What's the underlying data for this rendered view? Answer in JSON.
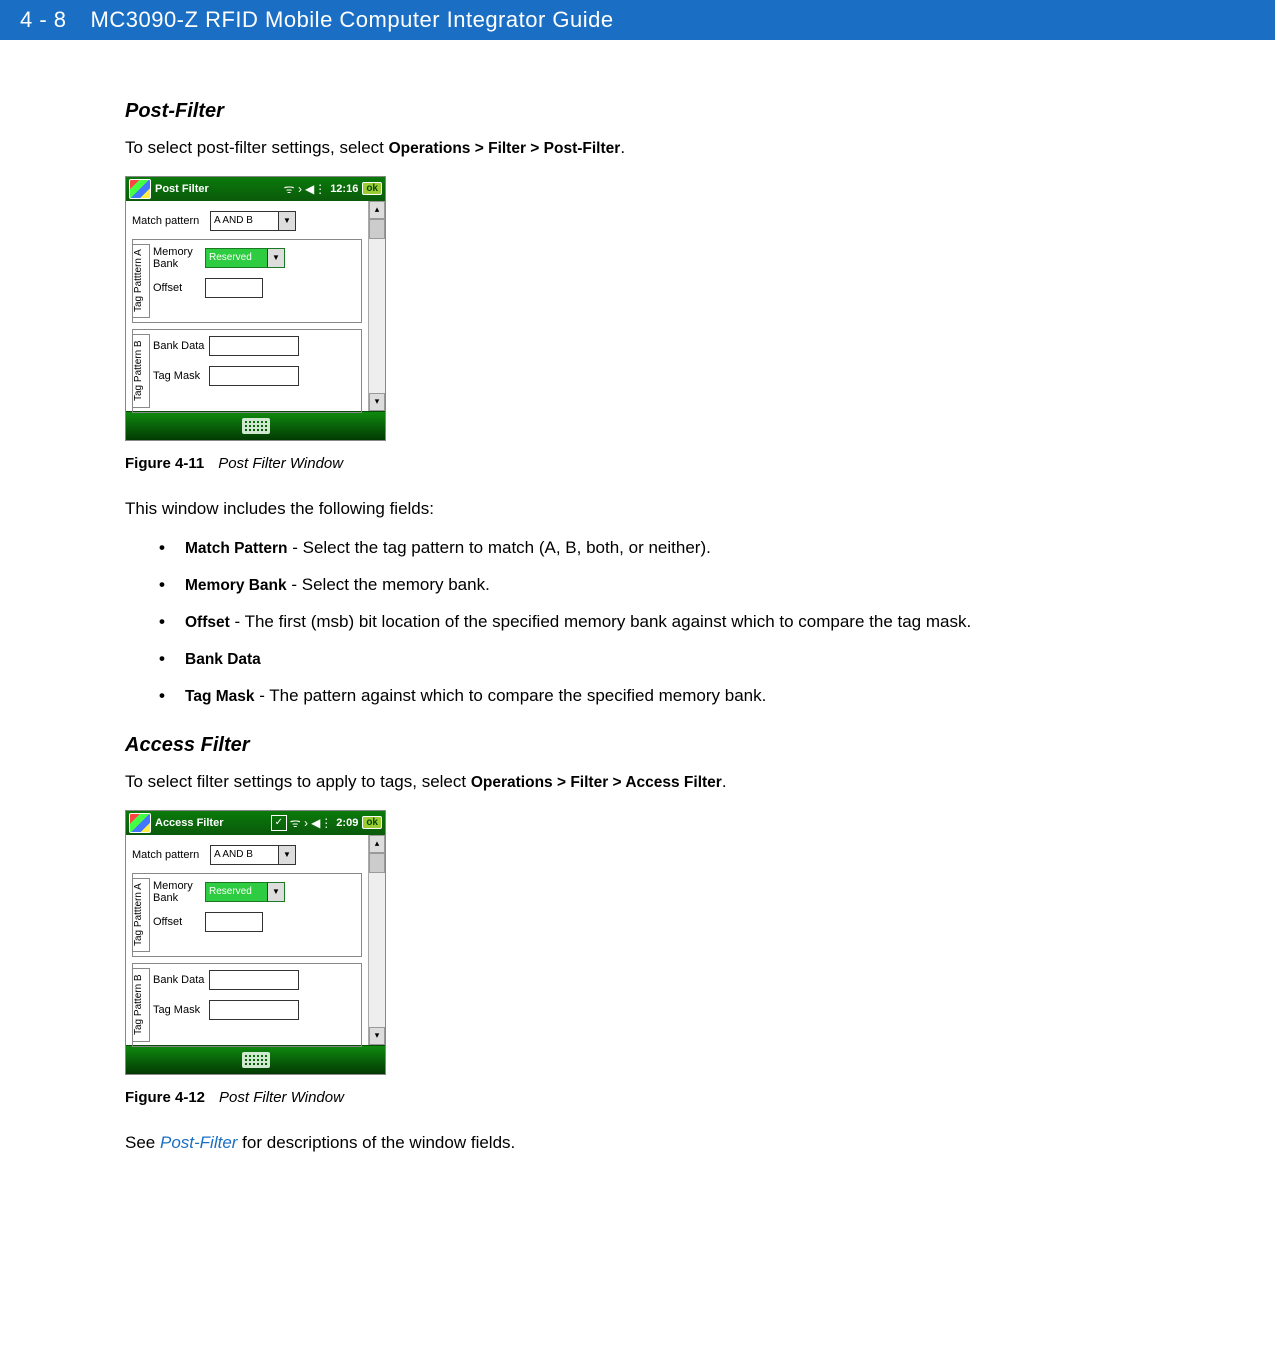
{
  "header": {
    "page_number": "4 - 8",
    "title": "MC3090-Z RFID Mobile Computer Integrator Guide"
  },
  "section1": {
    "heading": "Post-Filter",
    "intro_prefix": "To select post-filter settings, select ",
    "intro_path": "Operations > Filter > Post-Filter",
    "intro_suffix": "."
  },
  "device1": {
    "title": "Post Filter",
    "time": "12:16",
    "ok": "ok",
    "match_pattern_label": "Match pattern",
    "match_pattern_value": "A AND B",
    "group_a_label": "Tag Patttern A",
    "memory_bank_label": "Memory\nBank",
    "memory_bank_value": "Reserved",
    "offset_label": "Offset",
    "group_b_label": "Tag Pattern B",
    "bank_data_label": "Bank Data",
    "tag_mask_label": "Tag Mask"
  },
  "figure1": {
    "label": "Figure 4-11",
    "title": "Post Filter Window"
  },
  "fields_intro": "This window includes the following fields:",
  "bullets": [
    {
      "term": "Match Pattern",
      "desc": " - Select the tag pattern to match (A, B, both, or neither)."
    },
    {
      "term": "Memory Bank",
      "desc": " - Select the memory bank."
    },
    {
      "term": "Offset",
      "desc": " - The first (msb) bit location of the specified memory bank against which to compare the tag mask."
    },
    {
      "term": "Bank Data",
      "desc": ""
    },
    {
      "term": "Tag Mask",
      "desc": " - The pattern against which to compare the specified memory bank."
    }
  ],
  "section2": {
    "heading": "Access Filter",
    "intro_prefix": "To select filter settings to apply to tags, select ",
    "intro_path": "Operations > Filter > Access Filter",
    "intro_suffix": "."
  },
  "device2": {
    "title": "Access Filter",
    "time": "2:09",
    "ok": "ok",
    "match_pattern_label": "Match pattern",
    "match_pattern_value": "A AND B",
    "group_a_label": "Tag Patttern A",
    "memory_bank_label": "Memory\nBank",
    "memory_bank_value": "Reserved",
    "offset_label": "Offset",
    "group_b_label": "Tag Pattern B",
    "bank_data_label": "Bank Data",
    "tag_mask_label": "Tag Mask"
  },
  "figure2": {
    "label": "Figure 4-12",
    "title": "Post Filter Window"
  },
  "footer": {
    "see_prefix": "See ",
    "see_link": "Post-Filter",
    "see_suffix": " for descriptions of the window fields."
  }
}
